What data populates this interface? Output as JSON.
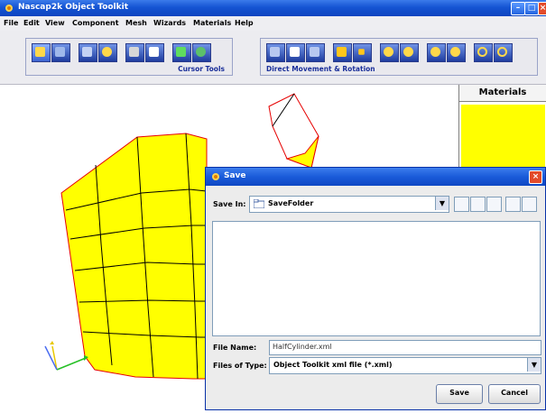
{
  "window": {
    "title": "Nascap2k Object Toolkit",
    "controls": [
      "minimize",
      "maximize",
      "close"
    ]
  },
  "menu": [
    "File",
    "Edit",
    "View",
    "Component",
    "Mesh",
    "Wizards",
    "Materials",
    "Help"
  ],
  "toolbar": {
    "group1_label": "Cursor Tools",
    "group2_label": "Direct Movement & Rotation",
    "group1_icons": [
      "cube-select-icon",
      "cube-rotate-icon",
      "cube-face-icon",
      "cube-node-icon",
      "zoom-icon",
      "box-icon",
      "pan-icon",
      "globe-icon"
    ],
    "group2_icons": [
      "move-left-icon",
      "move-center-icon",
      "move-right-icon",
      "square-icon",
      "stop-icon",
      "rotate-1-icon",
      "rotate-2-icon",
      "rotate-3-icon",
      "rotate-4-icon",
      "spin-cw-icon",
      "spin-ccw-icon"
    ]
  },
  "materials": {
    "header": "Materials",
    "swatch_color": "#ffff00"
  },
  "mesh": {
    "fill": "#ffff00",
    "edge": "#e60000",
    "grid": "#000000"
  },
  "save_dialog": {
    "title": "Save",
    "save_in_label": "Save In:",
    "save_in_value": "SaveFolder",
    "file_name_label": "File Name:",
    "file_name_value": "HalfCylinder.xml",
    "files_of_type_label": "Files of Type:",
    "files_of_type_value": "Object Toolkit xml file (*.xml)",
    "save_button": "Save",
    "cancel_button": "Cancel",
    "nav_icons": [
      "up-folder-icon",
      "home-icon",
      "new-folder-icon",
      "list-view-icon",
      "details-view-icon"
    ]
  }
}
